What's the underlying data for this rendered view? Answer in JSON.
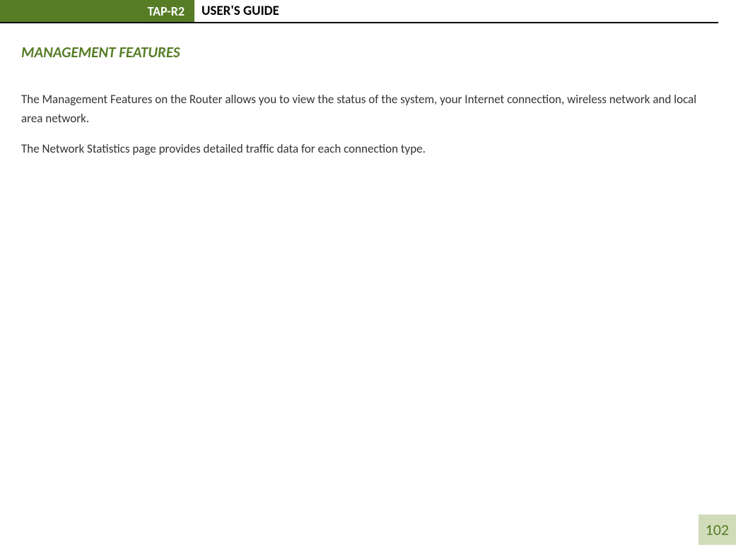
{
  "header": {
    "badge": "TAP-R2",
    "title": "USER'S GUIDE"
  },
  "section": {
    "heading": "MANAGEMENT FEATURES"
  },
  "paragraphs": {
    "p1": "The Management Features on the Router allows you to view the status of the system, your Internet connection, wireless network and local area network.",
    "p2": "The Network Statistics page provides detailed traffic data for each connection type."
  },
  "page_number": "102"
}
